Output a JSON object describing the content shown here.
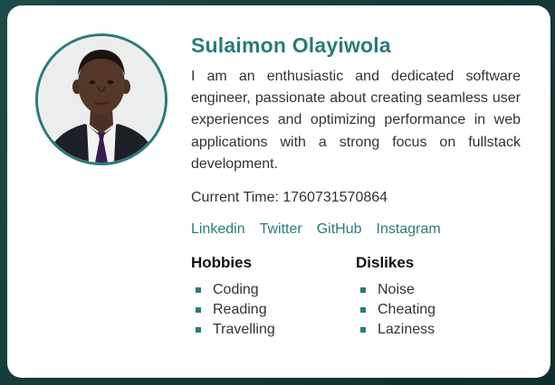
{
  "profile": {
    "name": "Sulaimon Olayiwola",
    "bio": "I am an enthusiastic and dedicated software engineer, passionate about creating seamless user experiences and optimizing performance in web applications with a strong focus on fullstack development.",
    "current_time": "Current Time: 1760731570864",
    "avatar_icon": "profile-photo"
  },
  "links": [
    {
      "label": "Linkedin"
    },
    {
      "label": "Twitter"
    },
    {
      "label": "GitHub"
    },
    {
      "label": "Instagram"
    }
  ],
  "hobbies": {
    "title": "Hobbies",
    "items": [
      "Coding",
      "Reading",
      "Travelling"
    ]
  },
  "dislikes": {
    "title": "Dislikes",
    "items": [
      "Noise",
      "Cheating",
      "Laziness"
    ]
  },
  "colors": {
    "accent": "#2b7a7b",
    "background": "#163a3a",
    "card": "#ffffff",
    "text": "#333333"
  }
}
